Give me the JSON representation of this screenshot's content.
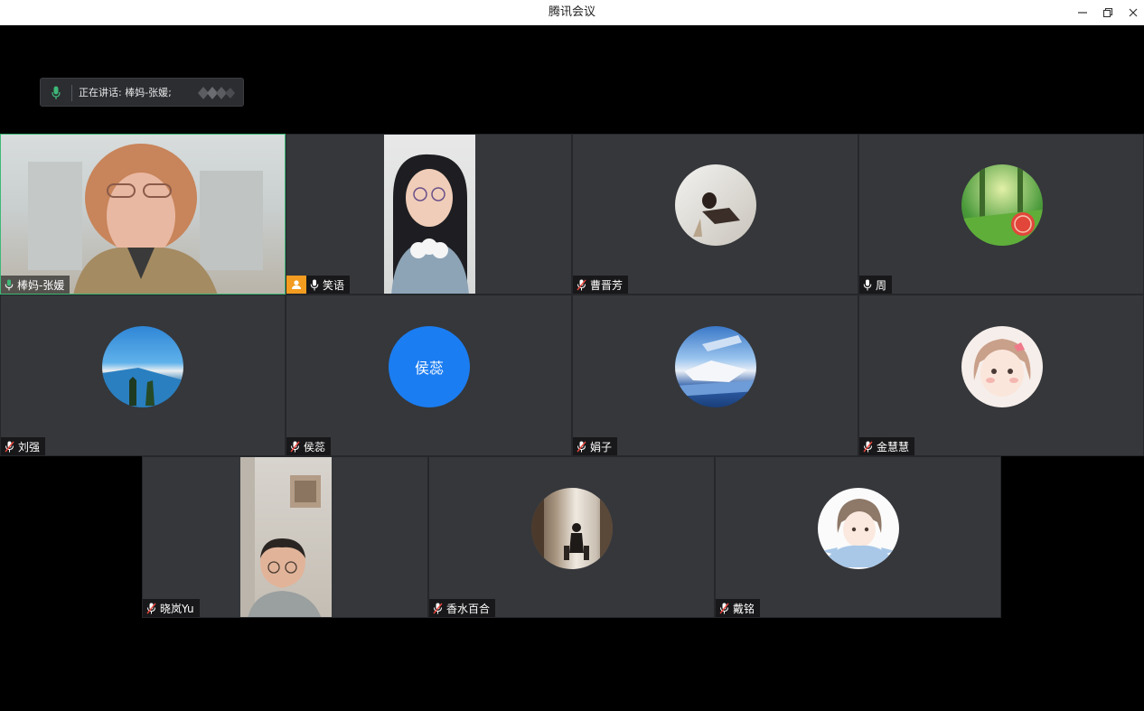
{
  "window": {
    "title": "腾讯会议",
    "minimize_icon": "minimize-icon",
    "restore_icon": "restore-icon",
    "close_icon": "close-icon"
  },
  "speaking": {
    "label": "正在讲话: 棒妈-张媛;"
  },
  "colors": {
    "accent_speaking": "#3fb878",
    "host_badge": "#f39c20",
    "avatar_blue": "#1b7df2",
    "tile_bg": "#35373b"
  },
  "participants": [
    {
      "name": "棒妈-张媛",
      "mic": "speaking",
      "view": "video"
    },
    {
      "name": "笑语",
      "mic": "on",
      "view": "video",
      "host": true
    },
    {
      "name": "曹晋芳",
      "mic": "muted",
      "view": "avatar"
    },
    {
      "name": "周",
      "mic": "on",
      "view": "avatar"
    },
    {
      "name": "刘强",
      "mic": "muted",
      "view": "avatar"
    },
    {
      "name": "侯蕊",
      "mic": "muted",
      "view": "text-avatar",
      "avatar_text": "侯蕊"
    },
    {
      "name": "娟子",
      "mic": "muted",
      "view": "avatar"
    },
    {
      "name": "金慧慧",
      "mic": "muted",
      "view": "avatar"
    },
    {
      "name": "晓岚Yu",
      "mic": "muted",
      "view": "video"
    },
    {
      "name": "香水百合",
      "mic": "muted",
      "view": "avatar"
    },
    {
      "name": "戴铭",
      "mic": "muted",
      "view": "avatar"
    }
  ]
}
